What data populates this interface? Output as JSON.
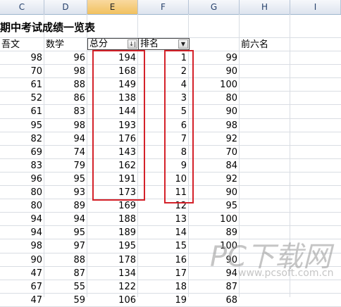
{
  "columns": [
    "C",
    "D",
    "E",
    "F",
    "G",
    "H",
    "I"
  ],
  "title": "期中考试成绩一览表",
  "headers": {
    "chinese": "吾文",
    "math": "数学",
    "total": "总分",
    "rank": "排名",
    "top6": "前六名"
  },
  "rows": [
    {
      "c": "98",
      "d": "96",
      "e": "194",
      "f": "1",
      "g": "99"
    },
    {
      "c": "70",
      "d": "98",
      "e": "168",
      "f": "2",
      "g": "90"
    },
    {
      "c": "61",
      "d": "88",
      "e": "149",
      "f": "4",
      "g": "100"
    },
    {
      "c": "52",
      "d": "86",
      "e": "138",
      "f": "3",
      "g": "80"
    },
    {
      "c": "61",
      "d": "83",
      "e": "144",
      "f": "5",
      "g": "90"
    },
    {
      "c": "95",
      "d": "98",
      "e": "193",
      "f": "6",
      "g": "98"
    },
    {
      "c": "82",
      "d": "94",
      "e": "176",
      "f": "7",
      "g": "92"
    },
    {
      "c": "69",
      "d": "74",
      "e": "143",
      "f": "8",
      "g": "70"
    },
    {
      "c": "83",
      "d": "79",
      "e": "162",
      "f": "9",
      "g": "84"
    },
    {
      "c": "96",
      "d": "95",
      "e": "191",
      "f": "10",
      "g": "92"
    },
    {
      "c": "80",
      "d": "93",
      "e": "173",
      "f": "11",
      "g": "90"
    },
    {
      "c": "80",
      "d": "89",
      "e": "169",
      "f": "12",
      "g": "95"
    },
    {
      "c": "94",
      "d": "94",
      "e": "188",
      "f": "13",
      "g": "100"
    },
    {
      "c": "94",
      "d": "95",
      "e": "189",
      "f": "14",
      "g": "89"
    },
    {
      "c": "98",
      "d": "97",
      "e": "195",
      "f": "15",
      "g": "100"
    },
    {
      "c": "90",
      "d": "88",
      "e": "178",
      "f": "16",
      "g": "90"
    },
    {
      "c": "47",
      "d": "87",
      "e": "134",
      "f": "17",
      "g": "94"
    },
    {
      "c": "67",
      "d": "55",
      "e": "122",
      "f": "18",
      "g": "87"
    },
    {
      "c": "47",
      "d": "59",
      "e": "106",
      "f": "19",
      "g": "68"
    }
  ],
  "filter_button_icons": {
    "total": "sort-ascending-filter-icon",
    "rank": "dropdown-filter-icon"
  },
  "filter_button_glyphs": {
    "total": "↓|",
    "rank": "▼"
  },
  "watermark": {
    "main": "PC下载网",
    "url": "www.pcsoft.com.cn"
  },
  "highlight_color": "#d4222a"
}
